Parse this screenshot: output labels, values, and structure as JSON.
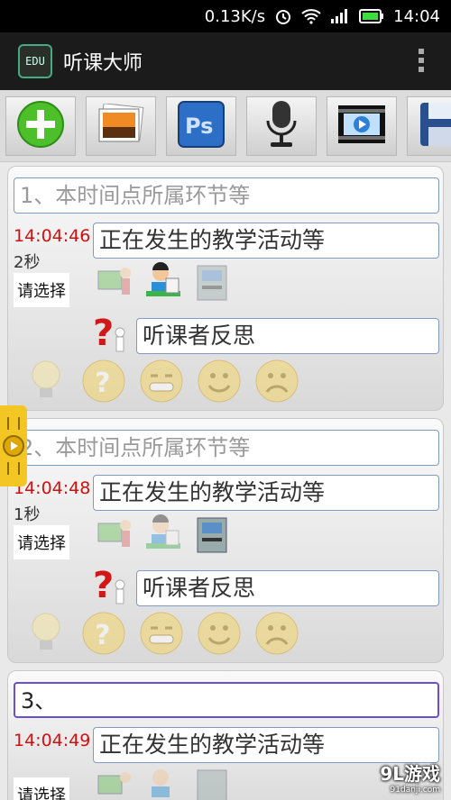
{
  "status": {
    "speed": "0.13K/s",
    "time": "14:04"
  },
  "app": {
    "logo": "EDU",
    "title": "听课大师"
  },
  "toolbar": {
    "buttons": [
      "add-icon",
      "gallery-icon",
      "photoshop-icon",
      "microphone-icon",
      "video-icon",
      "save-icon"
    ]
  },
  "records": [
    {
      "stage": "1、本时间点所属环节等",
      "time": "14:04:46",
      "duration": "2秒",
      "activity": "正在发生的教学活动等",
      "select": "请选择",
      "reflection": "听课者反思"
    },
    {
      "stage": "2、本时间点所属环节等",
      "time": "14:04:48",
      "duration": "1秒",
      "activity": "正在发生的教学活动等",
      "select": "请选择",
      "reflection": "听课者反思"
    },
    {
      "stage": "3、",
      "time": "14:04:49",
      "activity": "正在发生的教学活动等",
      "select": "请选择"
    }
  ],
  "watermark": {
    "brand": "9L游戏",
    "site": "91danji.com"
  }
}
